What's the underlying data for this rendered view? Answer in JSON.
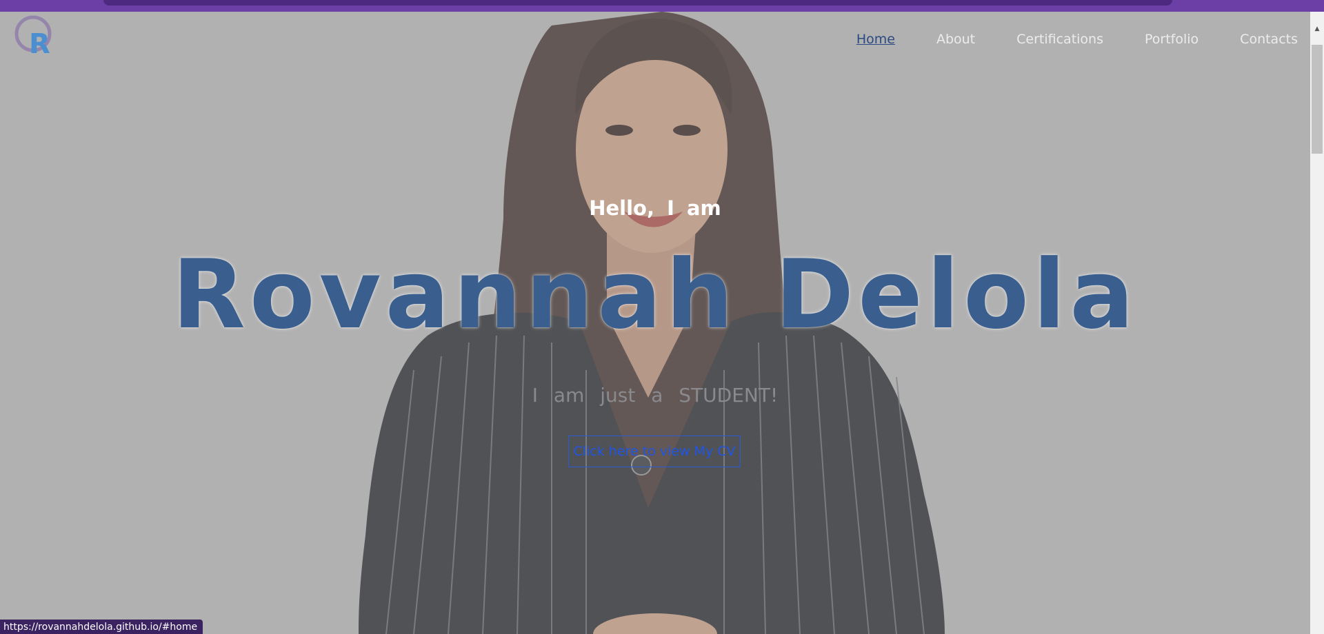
{
  "nav": {
    "logo_letter": "R",
    "items": [
      {
        "label": "Home",
        "active": true
      },
      {
        "label": "About",
        "active": false
      },
      {
        "label": "Certifications",
        "active": false
      },
      {
        "label": "Portfolio",
        "active": false
      },
      {
        "label": "Contacts",
        "active": false
      }
    ]
  },
  "hero": {
    "greeting": "Hello, I am",
    "name": "Rovannah Delola",
    "tagline": "I am just a STUDENT!",
    "cv_button": "Click here to view My CV"
  },
  "status_bar": {
    "url": "https://rovannahdelola.github.io/#home"
  },
  "colors": {
    "accent_purple": "#6b3fa6",
    "name_blue": "#3a5f8e",
    "button_blue": "#1f56e6"
  }
}
